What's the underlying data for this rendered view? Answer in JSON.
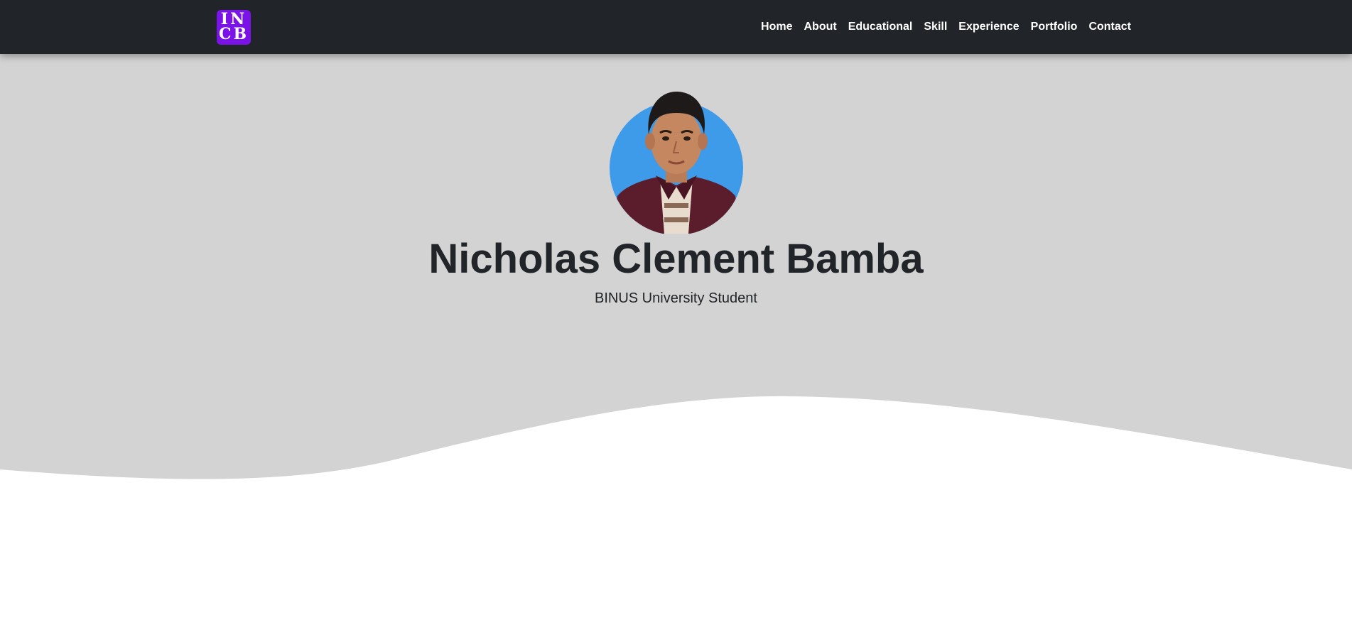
{
  "navbar": {
    "brand": {
      "line1": "IN",
      "line2": "CB",
      "color": "#7b12e8"
    },
    "links": [
      "Home",
      "About",
      "Educational",
      "Skill",
      "Experience",
      "Portfolio",
      "Contact"
    ],
    "background": "#212529"
  },
  "hero": {
    "name": "Nicholas Clement Bamba",
    "subtitle": "BINUS University Student",
    "background": "#d3d3d4",
    "avatar_background": "#3d9be9"
  }
}
